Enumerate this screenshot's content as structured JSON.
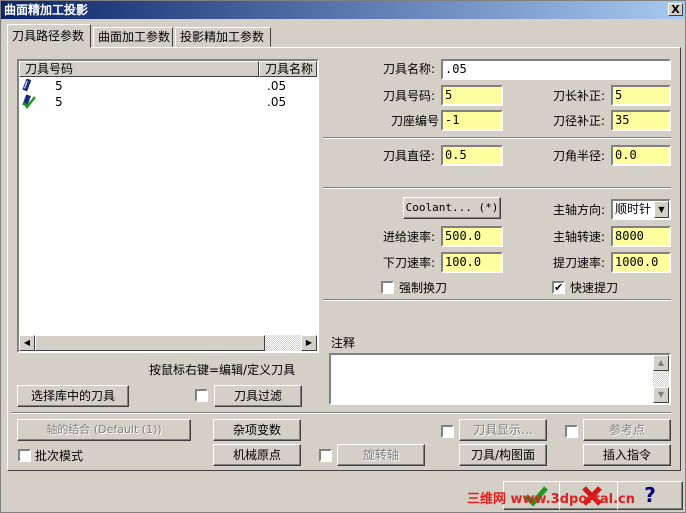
{
  "window": {
    "title": "曲面精加工投影",
    "close": "X"
  },
  "tabs": [
    "刀具路径参数",
    "曲面加工参数",
    "投影精加工参数"
  ],
  "tool_list": {
    "headers": [
      "刀具号码",
      "刀具名称"
    ],
    "rows": [
      {
        "number": "5",
        "name": ".05",
        "icon": "tool-icon"
      },
      {
        "number": "5",
        "name": ".05",
        "icon": "tool-checked-icon"
      }
    ]
  },
  "hint": "按鼠标右键=编辑/定义刀具",
  "buttons": {
    "select_library": "选择库中的刀具",
    "tool_filter": "刀具过滤",
    "axis_combo": "轴的结合 (Default (1))",
    "misc_vars": "杂项变数",
    "tool_display": "刀具显示...",
    "reference_point": "参考点",
    "machine_origin": "机械原点",
    "rotary_axis": "旋转轴",
    "tool_plane": "刀具/构图面",
    "insert_cmd": "插入指令",
    "coolant": "Coolant... (*)"
  },
  "fields": {
    "tool_name_label": "刀具名称:",
    "tool_name": ".05",
    "tool_number_label": "刀具号码:",
    "tool_number": "5",
    "length_comp_label": "刀长补正:",
    "length_comp": "5",
    "holder_label": "刀座编号",
    "holder": "-1",
    "dia_comp_label": "刀径补正:",
    "dia_comp": "35",
    "diameter_label": "刀具直径:",
    "diameter": "0.5",
    "corner_radius_label": "刀角半径:",
    "corner_radius": "0.0",
    "spindle_dir_label": "主轴方向:",
    "spindle_dir": "顺时针",
    "feed_label": "进给速率:",
    "feed": "500.0",
    "spindle_speed_label": "主轴转速:",
    "spindle_speed": "8000",
    "plunge_label": "下刀速率:",
    "plunge": "100.0",
    "retract_label": "提刀速率:",
    "retract": "1000.0"
  },
  "checkboxes": {
    "force_change": {
      "label": "强制换刀",
      "checked": false
    },
    "rapid_retract": {
      "label": "快速提刀",
      "checked": true
    },
    "tool_filter": {
      "checked": false
    },
    "batch_mode": {
      "label": "批次模式",
      "checked": false
    },
    "tool_display": {
      "checked": false
    },
    "reference_point": {
      "checked": false
    },
    "rotary_axis": {
      "checked": false
    }
  },
  "notes_label": "注释",
  "watermark": "三维网 www.3dportal.cn",
  "colors": {
    "field_bg": "#ffffa0",
    "title_start": "#0a246a",
    "ok_green": "#1c9a1c",
    "cancel_red": "#d01818"
  }
}
